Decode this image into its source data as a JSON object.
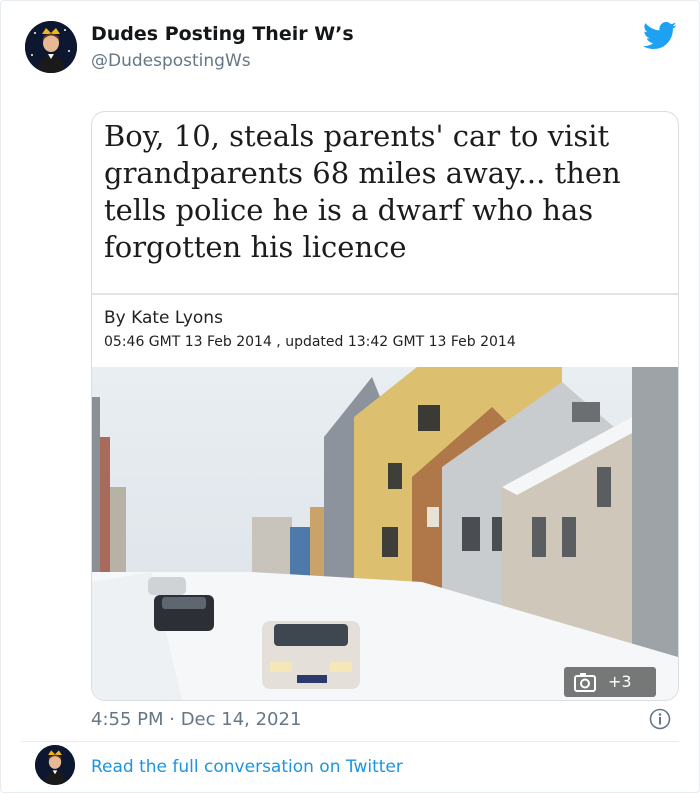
{
  "tweet": {
    "display_name": "Dudes Posting Their W’s",
    "handle": "@DudespostingWs",
    "timestamp": "4:55 PM · Dec 14, 2021",
    "read_more": "Read the full conversation on Twitter"
  },
  "article": {
    "headline": "Boy, 10, steals parents' car to visit grandparents 68 miles away... then tells police he is a dwarf who has forgotten his licence",
    "byline": "By Kate Lyons",
    "dates": "05:46 GMT 13 Feb 2014 , updated 13:42 GMT 13 Feb 2014",
    "gallery_count": "+3"
  },
  "icons": {
    "brand": "twitter-bird-icon",
    "gallery": "camera-icon",
    "info": "info-icon"
  },
  "colors": {
    "twitter_blue": "#1da1f2",
    "link_blue": "#1b95e0",
    "muted": "#657786"
  }
}
